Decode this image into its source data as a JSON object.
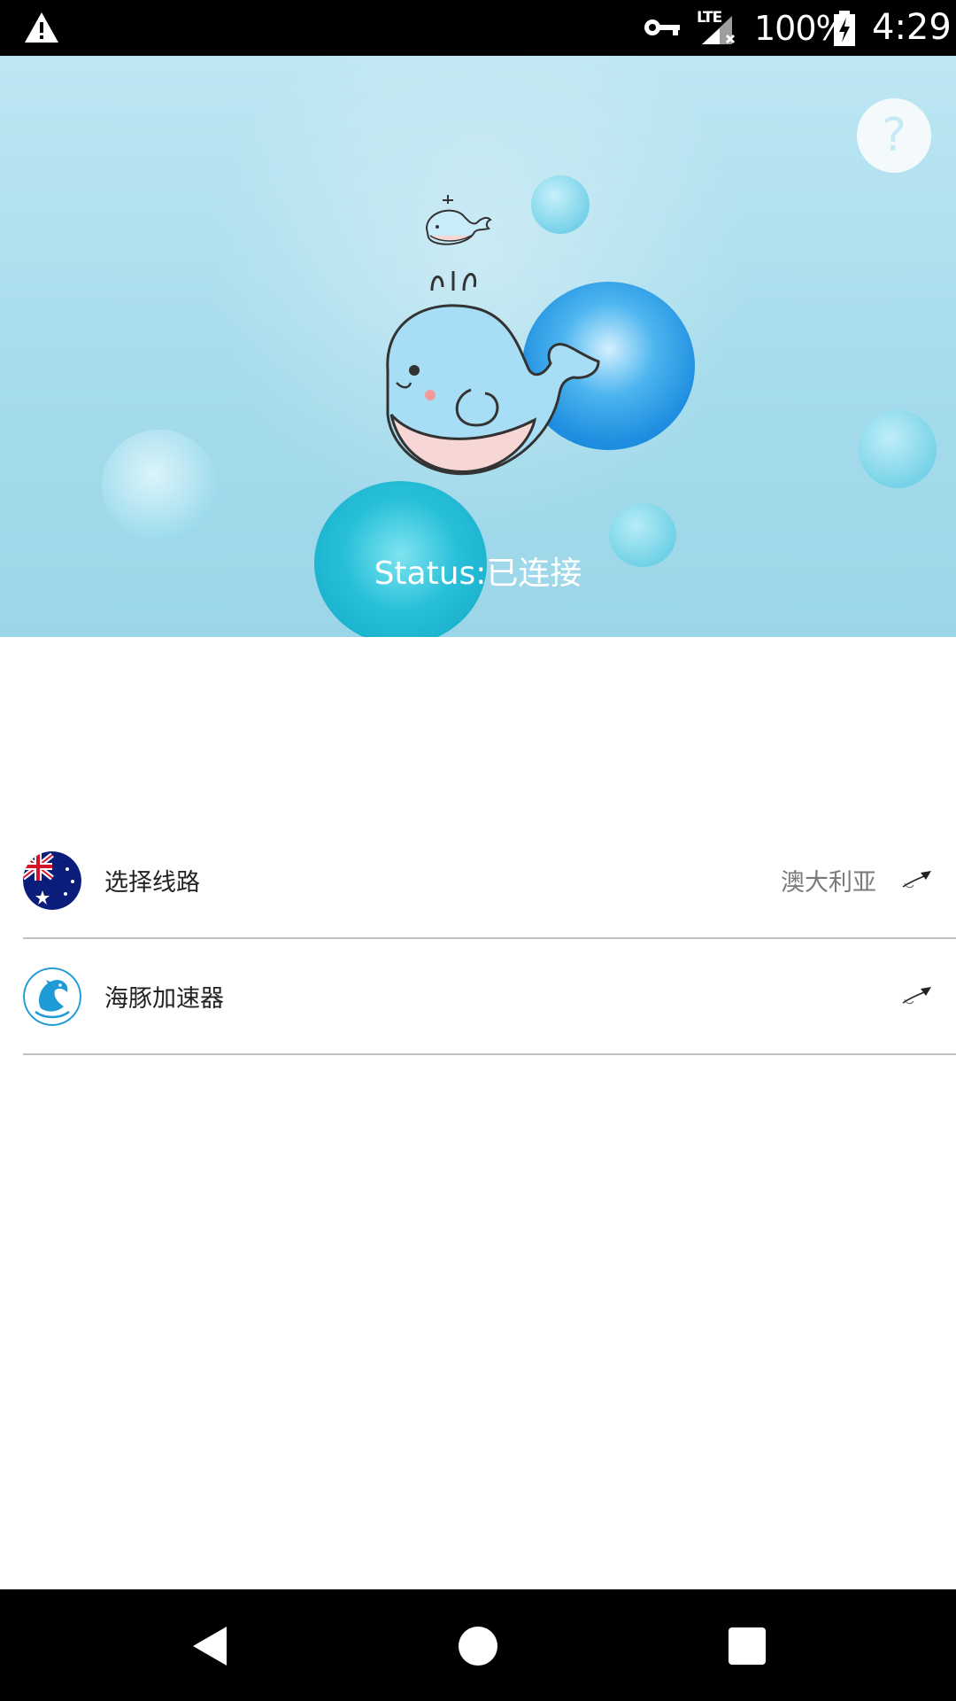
{
  "status_bar": {
    "lte_label": "LTE",
    "battery_percent": "100%",
    "time": "4:29",
    "icons": [
      "warning-icon",
      "vpn-key-icon",
      "signal-icon",
      "battery-charging-icon"
    ]
  },
  "hero": {
    "help_label": "?",
    "status_text": "Status:已连接"
  },
  "list": {
    "items": [
      {
        "icon": "australia-flag-icon",
        "label": "选择线路",
        "value": "澳大利亚",
        "arrow": "arrow-icon"
      },
      {
        "icon": "dolphin-logo-icon",
        "label": "海豚加速器",
        "value": "",
        "arrow": "arrow-icon"
      }
    ]
  },
  "nav_bar": {
    "icons": [
      "back-icon",
      "home-icon",
      "recents-icon"
    ]
  },
  "colors": {
    "hero_sky": "#a6dcec",
    "whale_body": "#a8def5",
    "whale_belly": "#f7d6d6",
    "divider": "#bfbfbf",
    "dolphin_blue": "#1e9ad6",
    "flag_navy": "#0a1d7a",
    "flag_red": "#d8112b"
  }
}
